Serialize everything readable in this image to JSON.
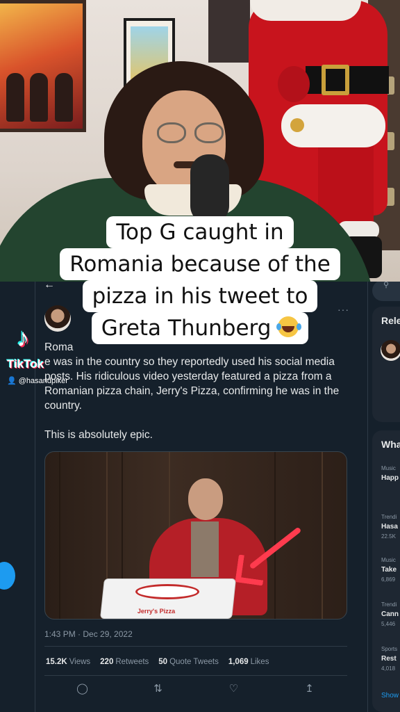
{
  "caption": {
    "line1": "Top G caught in",
    "line2": "Romania because of the",
    "line3": "pizza in his tweet to",
    "line4": "Greta Thunberg"
  },
  "tiktok": {
    "brand": "TikTok",
    "username": "@hasandpiker"
  },
  "tweet": {
    "back_icon": "arrow-left-icon",
    "more_icon": "more-icon",
    "text_line1_start": "Roma",
    "text_line1_end": "e",
    "text_rest": "was in the country so they reportedly used his social media posts. His ridiculous video yesterday featured a pizza from a Romanian pizza chain, Jerry's Pizza, confirming he was in the country.",
    "text_second": "This is absolutely epic.",
    "media": {
      "box_brand": "Jerry's Pizza"
    },
    "timestamp": "1:43 PM · Dec 29, 2022",
    "stats": [
      {
        "value": "15.2K",
        "label": "Views"
      },
      {
        "value": "220",
        "label": "Retweets"
      },
      {
        "value": "50",
        "label": "Quote Tweets"
      },
      {
        "value": "1,069",
        "label": "Likes"
      }
    ],
    "actions": [
      "reply-icon",
      "retweet-icon",
      "like-icon",
      "share-icon"
    ]
  },
  "sidebar": {
    "search_icon": "search-icon",
    "relevant_title": "Rele",
    "whats_title": "Wha",
    "trends": [
      {
        "cat": "Music",
        "name": "Happ",
        "count": ""
      },
      {
        "cat": "Trendi",
        "name": "Hasa",
        "count": "22.5K"
      },
      {
        "cat": "Music",
        "name": "Take",
        "count": "6,869"
      },
      {
        "cat": "Trendi",
        "name": "Cann",
        "count": "5,446"
      },
      {
        "cat": "Sports",
        "name": "Rest",
        "count": "4,018"
      }
    ],
    "show_more": "Show"
  }
}
